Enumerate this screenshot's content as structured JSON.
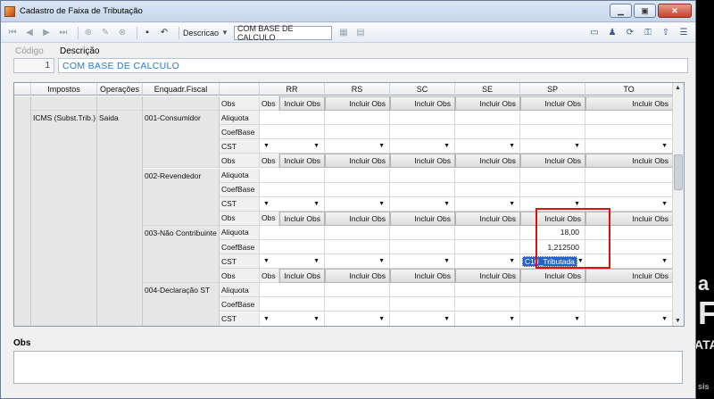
{
  "window": {
    "title": "Cadastro de Faixa de Tributação"
  },
  "toolbar": {
    "search_label": "Descricao",
    "search_value": "COM BASE DE CALCULO"
  },
  "form": {
    "code_label": "Código",
    "code_value": "1",
    "desc_label": "Descrição",
    "desc_value": "COM BASE DE CALCULO"
  },
  "grid": {
    "headers": [
      "Impostos",
      "Operações",
      "Enquadr.Fiscal",
      "",
      "RR",
      "RS",
      "SC",
      "SE",
      "SP",
      "TO"
    ],
    "imposto": "ICMS (Subst.Trib.)",
    "operacao": "Saida",
    "row_labels": [
      "Obs",
      "Aliquota",
      "CoefBase",
      "CST"
    ],
    "enquadramentos": [
      "001-Consumidor",
      "002-Revendedor",
      "003-Não Contribuinte",
      "004-Declaração ST"
    ],
    "obs_short": "Obs",
    "obs_button": "Incluir Obs",
    "sp_aliquota": "18,00",
    "sp_coefbase": "1,212500",
    "sp_cst": "C10_Tributada"
  },
  "obs": {
    "label": "Obs"
  },
  "background": {
    "text_a": "a",
    "text_f": "F",
    "text_ata": "ATA",
    "text_sis": "sis"
  }
}
